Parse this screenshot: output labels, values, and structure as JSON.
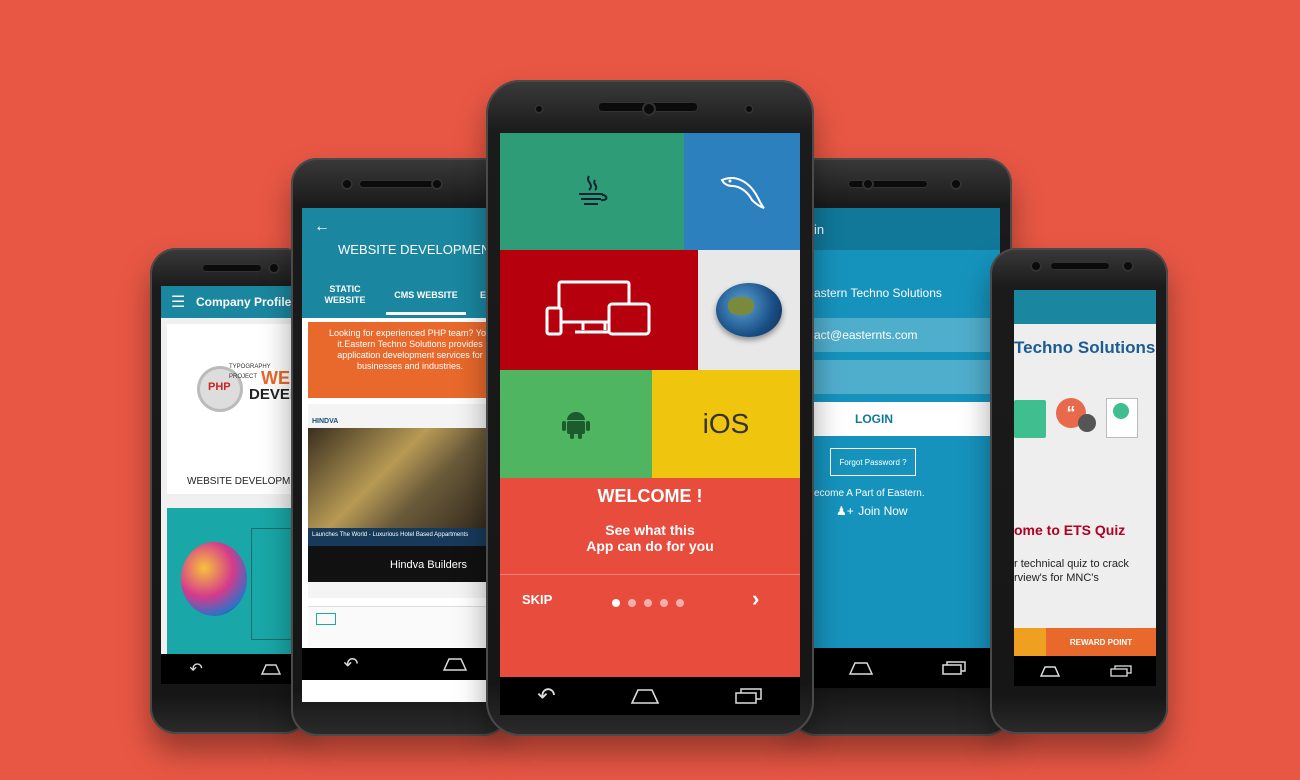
{
  "colors": {
    "background": "#e85744",
    "teal": "#1a869f",
    "welcome_red": "#e84c3d",
    "green": "#2e9c76",
    "blue": "#2c80be",
    "dark_red": "#b7000d",
    "android_green": "#4fb560",
    "yellow": "#f0c50e",
    "ets_orange": "#e8692b"
  },
  "phone1": {
    "title": "Company Profile",
    "card_label": "WEBSITE DEVELOPMI",
    "word_php": "PHP",
    "word_web": "WEB",
    "word_devel": "DEVELO",
    "word_typo": "TYPOGRAPHY",
    "word_project": "PROJECT"
  },
  "phone2": {
    "title": "WEBSITE DEVELOPMENT",
    "tabs": [
      "STATIC WEBSITE",
      "CMS WEBSITE",
      "E"
    ],
    "promo_text": "Looking for experienced PHP team? You it.Eastern Techno Solutions provides application development services for businesses and industries.",
    "hindva_banner": "Launches The World - Luxurious Hotel Based Appartments",
    "hindva_caption": "Hindva Builders",
    "hindva_logo": "HINDVA"
  },
  "phone3": {
    "java_icon": "java-icon",
    "mysql_icon": "mysql-dolphin-icon",
    "ios_label": "iOS",
    "welcome": "WELCOME !",
    "tagline_1": "See what this",
    "tagline_2": "App can do for you",
    "skip": "SKIP",
    "page_indicator": {
      "total": 5,
      "active": 1
    }
  },
  "phone4": {
    "title": "in",
    "company": "astern Techno Solutions",
    "email_value": "act@easternts.com",
    "password_value": "",
    "login": "LOGIN",
    "forgot": "Forgot Password ?",
    "become": "ecome A Part of Eastern.",
    "join": "Join Now"
  },
  "phone5": {
    "company": "Techno Solutions",
    "quiz_title": "ome to ETS Quiz",
    "quiz_desc_1": "r technical quiz to crack",
    "quiz_desc_2": "rview's for MNC's",
    "reward": "REWARD POINT"
  }
}
